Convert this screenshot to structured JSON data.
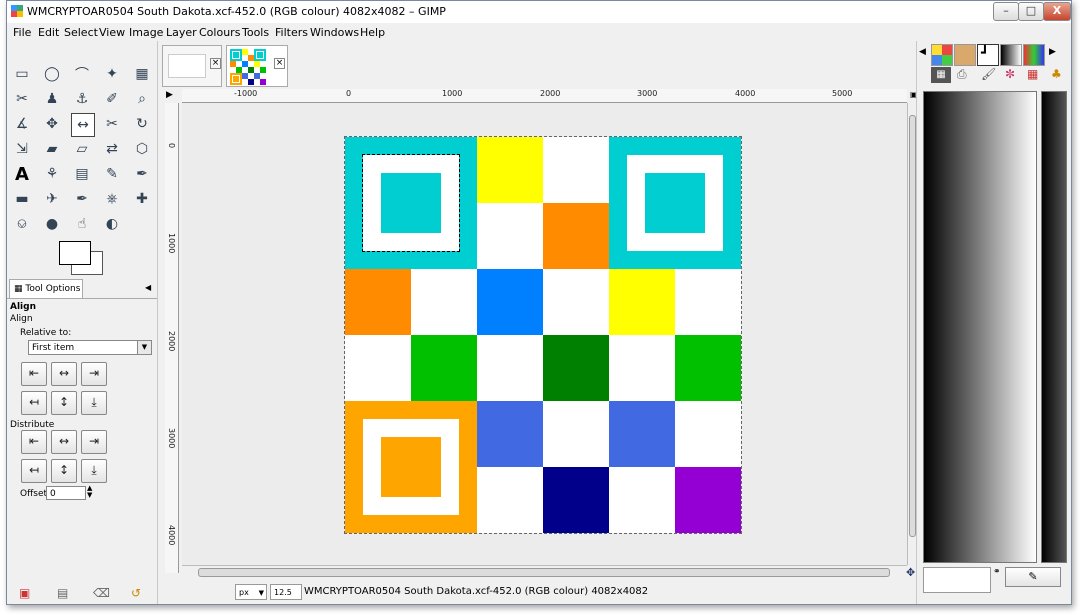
{
  "window": {
    "title": "WMCRYPTOAR0504 South Dakota.xcf-452.0 (RGB colour) 4082x4082 – GIMP",
    "minimize": "–",
    "maximize": "□",
    "close": "X"
  },
  "menu": [
    "File",
    "Edit",
    "Select",
    "View",
    "Image",
    "Layer",
    "Colours",
    "Tools",
    "Filters",
    "Windows",
    "Help"
  ],
  "toolbox": {
    "tools": [
      "rect-select",
      "ellipse-select",
      "free-select",
      "fuzzy-select",
      "select-by-color",
      "scissors-select",
      "foreground-select",
      "paths",
      "color-picker",
      "zoom",
      "measure",
      "move",
      "align",
      "crop",
      "rotate",
      "scale",
      "shear",
      "perspective",
      "flip",
      "cage-transform",
      "text",
      "bucket-fill",
      "blend",
      "pencil",
      "paintbrush",
      "eraser",
      "airbrush",
      "ink",
      "clone",
      "heal",
      "perspective-clone",
      "blur",
      "smudge",
      "dodge-burn"
    ],
    "selected_tool": "align"
  },
  "tool_options": {
    "tab_label": "Tool Options",
    "heading": "Align",
    "subheading": "Align",
    "relative_to_label": "Relative to:",
    "relative_to_value": "First item",
    "distribute_label": "Distribute",
    "offset_label": "Offset:",
    "offset_value": "0"
  },
  "rulers": {
    "horizontal": [
      "-1000",
      "0",
      "1000",
      "2000",
      "3000",
      "4000",
      "5000"
    ],
    "vertical": [
      "0",
      "1000",
      "2000",
      "3000",
      "4000"
    ]
  },
  "image_grid": [
    [
      "#00CED1",
      "#00CED1",
      "#FFFF00",
      "#FFFFFF",
      "#00CED1",
      "#00CED1"
    ],
    [
      "#00CED1",
      "#00CED1",
      "#FFFFFF",
      "#FF8C00",
      "#00CED1",
      "#00CED1"
    ],
    [
      "#FF8C00",
      "#FFFFFF",
      "#0080FF",
      "#FFFFFF",
      "#FFFF00",
      "#FFFFFF"
    ],
    [
      "#FFFFFF",
      "#00C000",
      "#FFFFFF",
      "#008000",
      "#FFFFFF",
      "#00C000"
    ],
    [
      "#FFA500",
      "#FFA500",
      "#4169E1",
      "#FFFFFF",
      "#4169E1",
      "#FFFFFF"
    ],
    [
      "#FFA500",
      "#FFA500",
      "#FFFFFF",
      "#00008B",
      "#FFFFFF",
      "#9400D3"
    ]
  ],
  "finder_colors": {
    "top_left": "#00CED1",
    "top_right": "#00CED1",
    "bottom_left": "#FFA500"
  },
  "status": {
    "unit": "px",
    "zoom": "12.5 %",
    "text": "WMCRYPTOAR0504 South Dakota.xcf-452.0 (RGB colour) 4082x4082"
  }
}
